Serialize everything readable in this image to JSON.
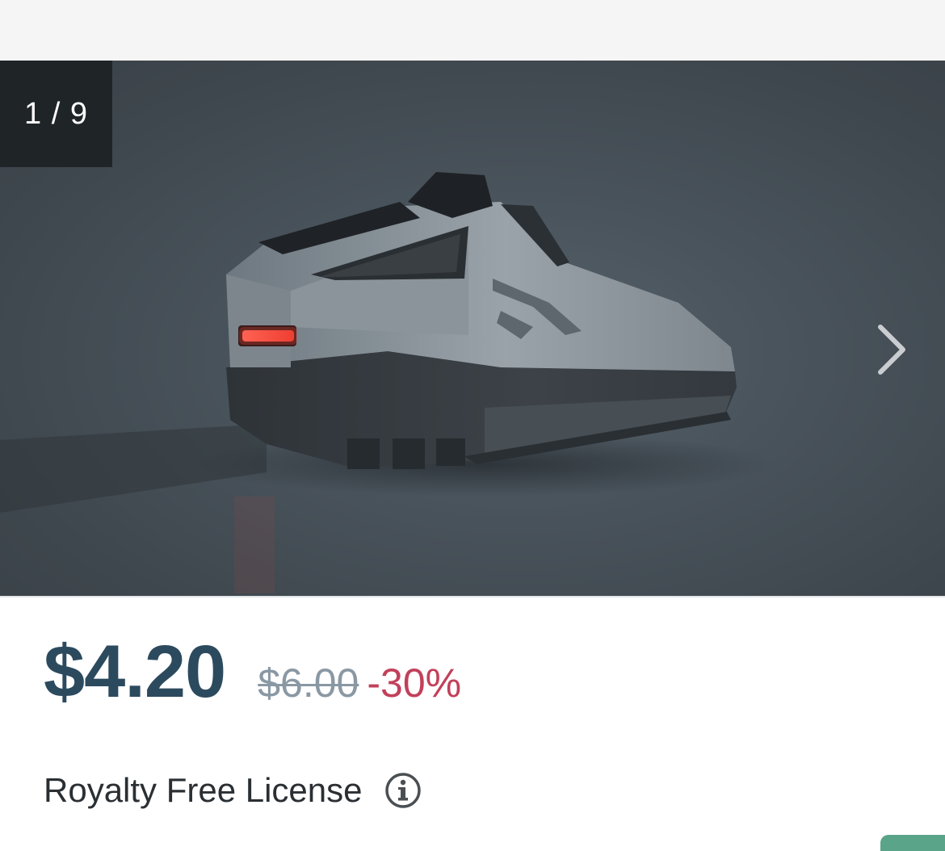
{
  "gallery": {
    "counter": "1 / 9",
    "next_icon": "chevron-right-icon",
    "image_subject": "product-3d-model"
  },
  "pricing": {
    "current": "$4.20",
    "original": "$6.00",
    "discount": "-30%",
    "colors": {
      "current": "#2c4a5e",
      "original": "#8a98a3",
      "discount": "#c2405a"
    }
  },
  "license": {
    "label": "Royalty Free License",
    "info_icon": "info-icon"
  }
}
